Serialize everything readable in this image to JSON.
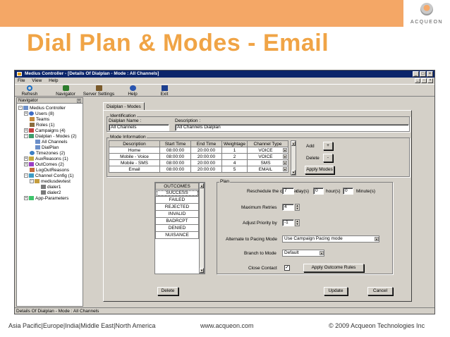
{
  "slide": {
    "title": "Dial Plan & Modes - Email",
    "logo_text": "ACQUEON",
    "footer_regions": "Asia Pacific|Europe|India|Middle East|North America",
    "footer_url": "www.acqueon.com",
    "footer_copyright": "© 2009 Acqueon Technologies Inc",
    "accent_color": "#f4a766",
    "title_color": "#f0a446"
  },
  "window": {
    "title": "Medius Controller - [Details Of Dialplan - Mode : All Channels]",
    "menu": [
      "File",
      "View",
      "Help"
    ],
    "toolbar": [
      {
        "label": "Refresh",
        "icon": "refresh-icon"
      },
      {
        "label": "Navigator",
        "icon": "navigator-icon"
      },
      {
        "label": "Server Settings",
        "icon": "server-settings-icon"
      },
      {
        "label": "Help",
        "icon": "help-icon"
      },
      {
        "label": "Exit",
        "icon": "exit-icon"
      }
    ],
    "status": "Details Of Dialplan - Mode : All Channels"
  },
  "navigator": {
    "header": "Navigator",
    "items": [
      {
        "label": "Medius Controller"
      },
      {
        "label": "Users (8)"
      },
      {
        "label": "Teams"
      },
      {
        "label": "Roles (1)"
      },
      {
        "label": "Campaigns (4)"
      },
      {
        "label": "Dialplan - Modes (2)"
      },
      {
        "label": "All Channels"
      },
      {
        "label": "DialPlan"
      },
      {
        "label": "Timezones (2)"
      },
      {
        "label": "AuxReasons (1)"
      },
      {
        "label": "OutComes (2)"
      },
      {
        "label": "LogOutReasons"
      },
      {
        "label": "Channel Config (1)"
      },
      {
        "label": "mediusdevtest"
      },
      {
        "label": "dialer1"
      },
      {
        "label": "dialer2"
      },
      {
        "label": "App-Parameters"
      }
    ]
  },
  "form": {
    "tab": "Dialplan - Modes",
    "identification": {
      "title": "Identification",
      "name_label": "Dialplan Name :",
      "name_value": "All Channels",
      "desc_label": "Description :",
      "desc_value": "All Channels Dialplan"
    },
    "mode_info": {
      "title": "Mode Information",
      "columns": [
        "Description",
        "Start Time",
        "End Time",
        "Weightage",
        "Channel Type"
      ],
      "rows": [
        [
          "Home",
          "08:00:00",
          "20:00:00",
          "1",
          "VOICE"
        ],
        [
          "Mobile - Voice",
          "08:00:00",
          "20:00:00",
          "2",
          "VOICE"
        ],
        [
          "Mobile - SMS",
          "08:00:00",
          "20:00:00",
          "4",
          "SMS"
        ],
        [
          "Email",
          "08:00:00",
          "20:00:00",
          "5",
          "EMAIL"
        ]
      ],
      "add_label": "Add",
      "add_btn": "+",
      "delete_label": "Delete",
      "delete_btn": "-",
      "apply_modes": "Apply Modes"
    },
    "outcomes": {
      "header": "OUTCOMES",
      "items": [
        "SUCCESS",
        "FAILED",
        "REJECTED",
        "INVALID",
        "BADRCPT",
        "DENIED",
        "NUISANCE"
      ]
    },
    "plan": {
      "title": "Plan",
      "reschedule_label": "Reschedule the call after",
      "days_value": "7",
      "days_unit": "day(s)",
      "hours_value": "0",
      "hours_unit": "hour(s)",
      "minutes_value": "0",
      "minutes_unit": "Minute(s)",
      "retries_label": "Maximum Retries",
      "retries_value": "4",
      "priority_label": "Adjust Priority by",
      "priority_value": "-1",
      "alternate_label": "Alternate to Pacing Mode",
      "alternate_value": "Use Campaign Pacing mode",
      "branch_label": "Branch to Mode",
      "branch_value": "Default",
      "close_label": "Close Contact",
      "close_checked": "✓",
      "apply_outcome": "Apply Outcome Rules"
    },
    "delete_btn": "Delete",
    "update_btn": "Update",
    "cancel_btn": "Cancel"
  }
}
